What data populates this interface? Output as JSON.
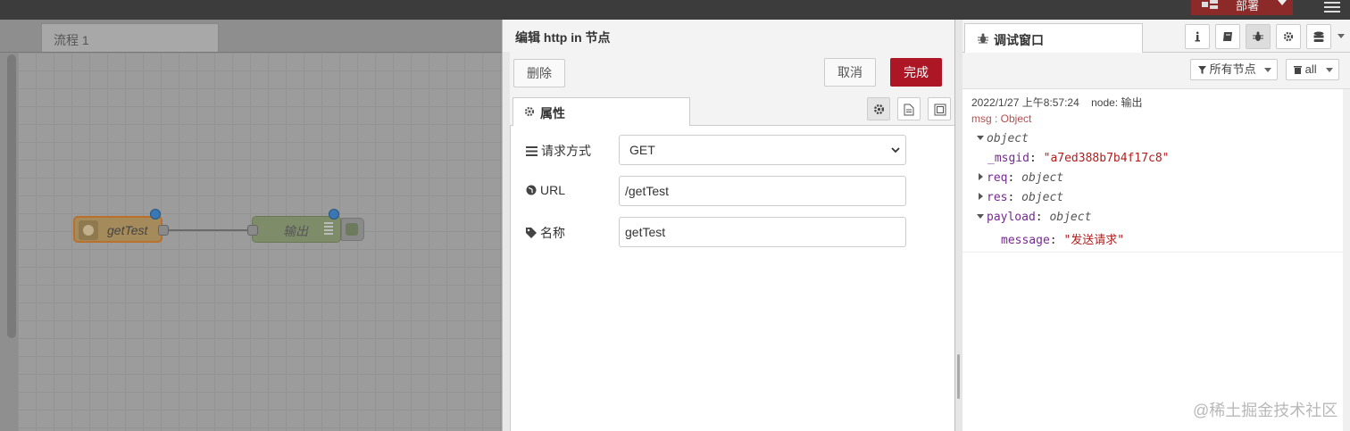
{
  "topbar": {
    "deploy_label": "部署"
  },
  "workspace": {
    "tab_label": "流程 1",
    "nodes": [
      {
        "label": "getTest"
      },
      {
        "label": "输出"
      }
    ]
  },
  "editor": {
    "title": "编辑 http in 节点",
    "delete_label": "删除",
    "cancel_label": "取消",
    "done_label": "完成",
    "tab_label": "属性",
    "fields": {
      "method": {
        "label": "请求方式",
        "value": "GET"
      },
      "url": {
        "label": "URL",
        "value": "/getTest"
      },
      "name": {
        "label": "名称",
        "value": "getTest"
      }
    },
    "icons": [
      "gear-icon",
      "document-icon",
      "frame-icon"
    ]
  },
  "sidebar": {
    "tab_label": "调试窗口",
    "icons": [
      "info-icon",
      "book-icon",
      "bug-icon",
      "gear-icon",
      "database-icon"
    ],
    "filter_label": "所有节点",
    "clear_label": "all",
    "debug": {
      "timestamp": "2022/1/27 上午8:57:24",
      "node": "node: 输出",
      "topic": "msg : Object",
      "root": "object",
      "msgid_key": "_msgid",
      "msgid_value": "\"a7ed388b7b4f17c8\"",
      "req_key": "req",
      "req_type": "object",
      "res_key": "res",
      "res_type": "object",
      "payload_key": "payload",
      "payload_type": "object",
      "message_key": "message",
      "message_value": "\"发送请求\""
    }
  },
  "watermark": "@稀土掘金技术社区",
  "colors": {
    "done_button": "#ad1625",
    "deploy_button": "#8c2a2a",
    "port_dot": "#3a78b5"
  }
}
